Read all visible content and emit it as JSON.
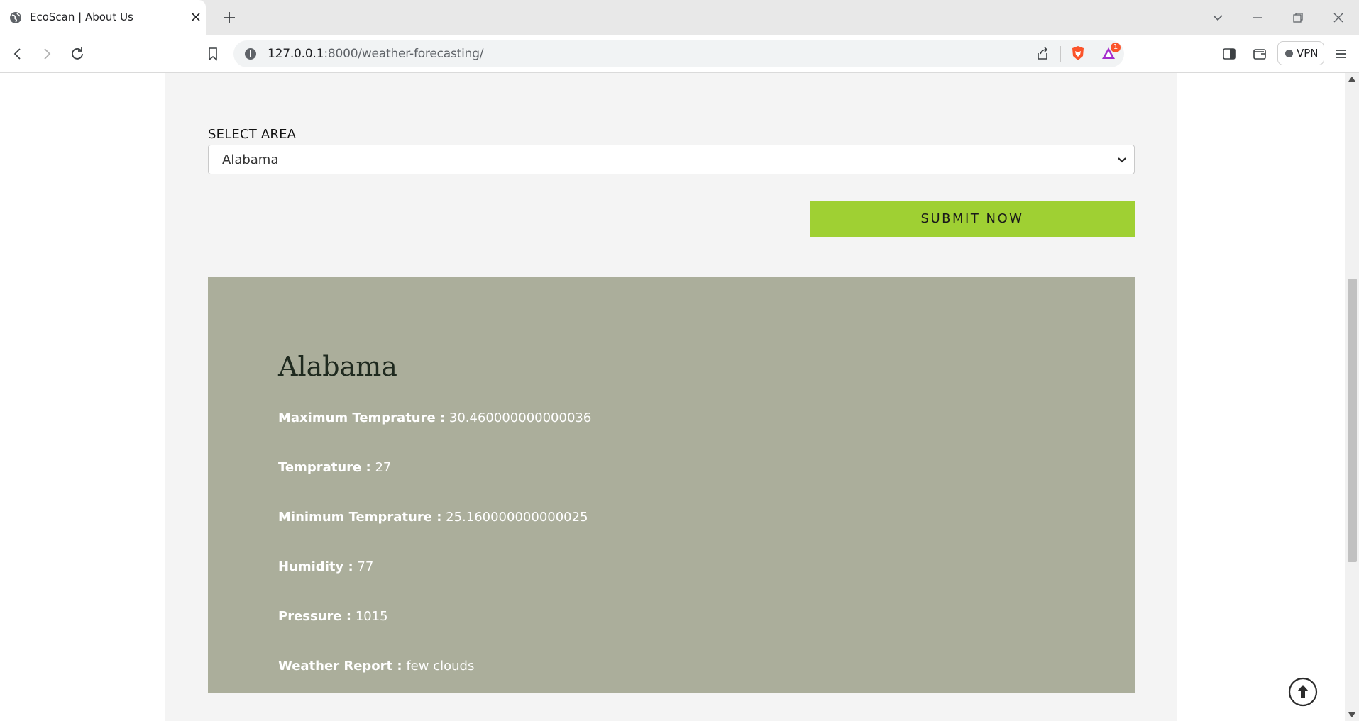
{
  "browser": {
    "tab_title": "EcoScan | About Us",
    "url_host": "127.0.0.1",
    "url_path": ":8000/weather-forecasting/",
    "vpn_label": "VPN",
    "notification_count": "1"
  },
  "form": {
    "area_label": "SELECT AREA",
    "area_selected": "Alabama",
    "submit_label": "SUBMIT NOW"
  },
  "result": {
    "title": "Alabama",
    "stats": [
      {
        "label": "Maximum Temprature :",
        "value": "30.460000000000036"
      },
      {
        "label": "Temprature :",
        "value": "27"
      },
      {
        "label": "Minimum Temprature :",
        "value": "25.160000000000025"
      },
      {
        "label": "Humidity :",
        "value": "77"
      },
      {
        "label": "Pressure :",
        "value": "1015"
      },
      {
        "label": "Weather Report :",
        "value": "few clouds"
      }
    ]
  },
  "colors": {
    "panel_bg": "#f4f4f4",
    "card_bg": "#abae9b",
    "submit_bg": "#9fd033"
  }
}
